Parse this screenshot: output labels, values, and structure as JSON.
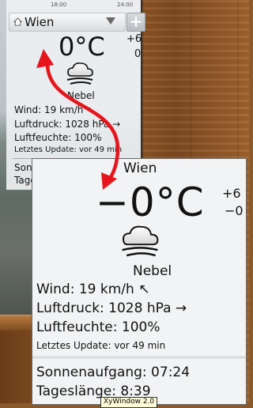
{
  "small_widget": {
    "time_axis": [
      "18:00",
      "24:00"
    ],
    "city": "Wien",
    "add_label": "+",
    "temp": "0°C",
    "hi": "+6",
    "lo": "0",
    "condition_icon": "fog-cloud-icon",
    "condition": "Nebel",
    "wind": "Wind:  19 km/h  ↖",
    "pressure": "Luftdruck:  1028 hPa  →",
    "humidity": "Luftfeuchte:  100%",
    "updated": "Letztes Update:  vor 49 min",
    "sunrise_partial": "Sonn",
    "daylength_partial": "Tage"
  },
  "large_widget": {
    "city": "Wien",
    "temp": "−0°C",
    "hi": "+6",
    "lo": "−0",
    "condition_icon": "fog-cloud-icon",
    "condition": "Nebel",
    "wind": "Wind:  19 km/h  ↖",
    "pressure": "Luftdruck:  1028 hPa  →",
    "humidity": "Luftfeuchte:  100%",
    "updated": "Letztes Update:  vor 49 min",
    "sunrise": "Sonnenaufgang:  07:24",
    "day_length": "Tageslänge:  8:39"
  },
  "tooltip": "XyWindow 2.0",
  "colors": {
    "arrow": "#e8141c",
    "widget_bg": "#f2f3f4",
    "wood": "#8c5426"
  }
}
